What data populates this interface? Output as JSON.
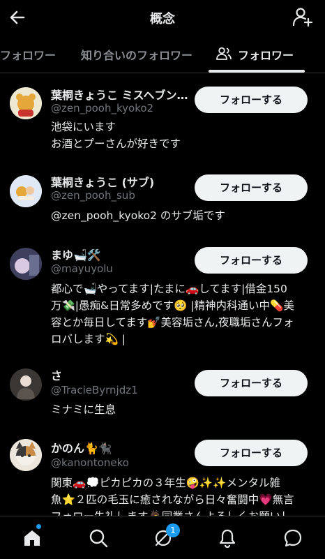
{
  "header": {
    "title": "概念",
    "back_icon": "arrow-left-icon",
    "add_user_icon": "add-user-icon"
  },
  "tabs": [
    {
      "label": "フォロワー"
    },
    {
      "label": "知り合いのフォロワー"
    },
    {
      "label": "フォロワー",
      "active": true
    }
  ],
  "users": [
    {
      "name": "葉桐きょうこ ミスヘブン…",
      "handle": "@zen_pooh_kyoko2",
      "bio": [
        "池袋にいます",
        "お酒とプーさんが好きです"
      ],
      "button": "フォローする"
    },
    {
      "name": "葉桐きょうこ (サブ)",
      "handle": "@zen_pooh_sub",
      "bio": [
        "@zen_pooh_kyoko2 のサブ垢です"
      ],
      "button": "フォローする"
    },
    {
      "name": "まゆ🛁🛠️",
      "handle": "@mayuyolu",
      "bio": [
        "都心で🛁やってます|たまに🚗してます|借金150",
        "万💸|愚痴&日常多めです🥺 |精神内科通い中💊美",
        "容とか毎日してます💅美容垢さん,夜職垢さんフォ",
        "ロバします💫 |"
      ],
      "button": "フォローする"
    },
    {
      "name": "さ",
      "handle": "@TracieByrnjdz1",
      "bio": [
        "ミナミに生息"
      ],
      "button": "フォローする"
    },
    {
      "name": "かのん🐈🐈‍⬛",
      "handle": "@kanontoneko",
      "bio": [
        "関東🚗💭ピカピカの３年生🤪✨✨メンタル雑",
        "魚⭐２匹の毛玉に癒されながら日々奮闘中💗無言",
        "フォロー失礼します🙇同業さんよろしくお願いし"
      ],
      "button": "フォローする"
    }
  ],
  "bottom_nav": {
    "items": [
      "home-icon",
      "search-icon",
      "spaces-icon",
      "notifications-icon",
      "messages-icon"
    ],
    "badge_count": "1"
  },
  "colors": {
    "background": "#000000",
    "text": "#e7e9ea",
    "muted": "#71767b",
    "button_bg": "#eff3f4",
    "accent": "#1d9bf0"
  }
}
